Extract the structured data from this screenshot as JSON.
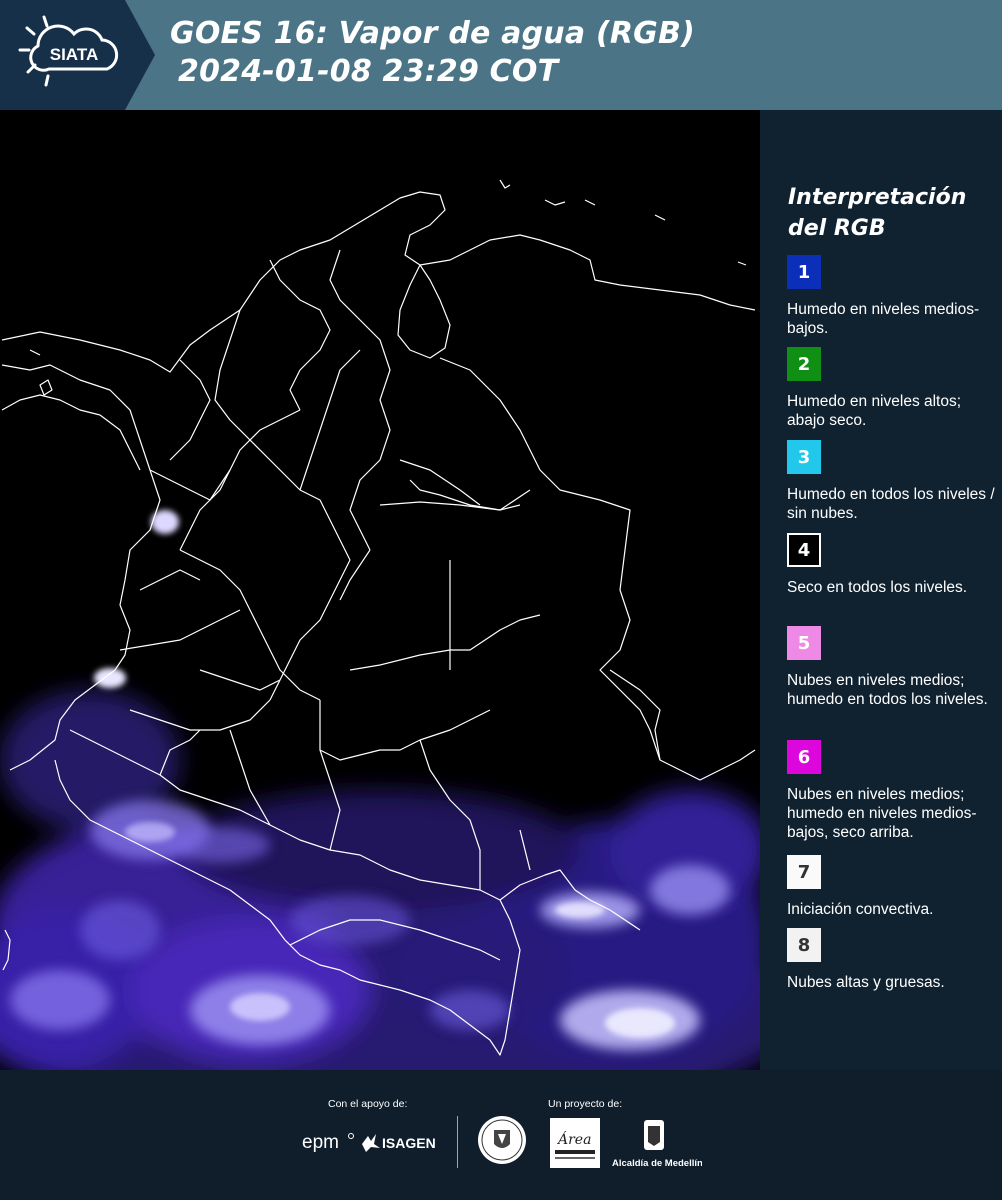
{
  "header": {
    "logo_text": "SIATA",
    "title_line1": "GOES 16: Vapor de agua (RGB)",
    "title_line2": "2024-01-08 23:29 COT"
  },
  "legend": {
    "title": "Interpretación del RGB",
    "items": [
      {
        "number": "1",
        "color": "#0b2fb9",
        "text": "Humedo en niveles medios-bajos."
      },
      {
        "number": "2",
        "color": "#0f8f14",
        "text": "Humedo en niveles altos; abajo seco."
      },
      {
        "number": "3",
        "color": "#22c8ec",
        "text": "Humedo en todos los niveles / sin nubes."
      },
      {
        "number": "4",
        "color": "#000000",
        "text": "Seco en todos los niveles."
      },
      {
        "number": "5",
        "color": "#ee8ae6",
        "text": "Nubes en niveles medios; humedo en todos los niveles."
      },
      {
        "number": "6",
        "color": "#dd06dc",
        "text": "Nubes en niveles medios; humedo en niveles medios-bajos, seco arriba."
      },
      {
        "number": "7",
        "color": "#fafafa",
        "text": "Iniciación convectiva."
      },
      {
        "number": "8",
        "color": "#f2f2f2",
        "text": "Nubes altas y gruesas."
      }
    ]
  },
  "footer": {
    "support_label": "Con el apoyo de:",
    "project_label": "Un proyecto de:",
    "sponsors": [
      "epm",
      "ISAGEN"
    ],
    "partners": [
      "Antioquia",
      "Área Metropolitana Valle de Aburrá",
      "Alcaldía de Medellín"
    ]
  }
}
